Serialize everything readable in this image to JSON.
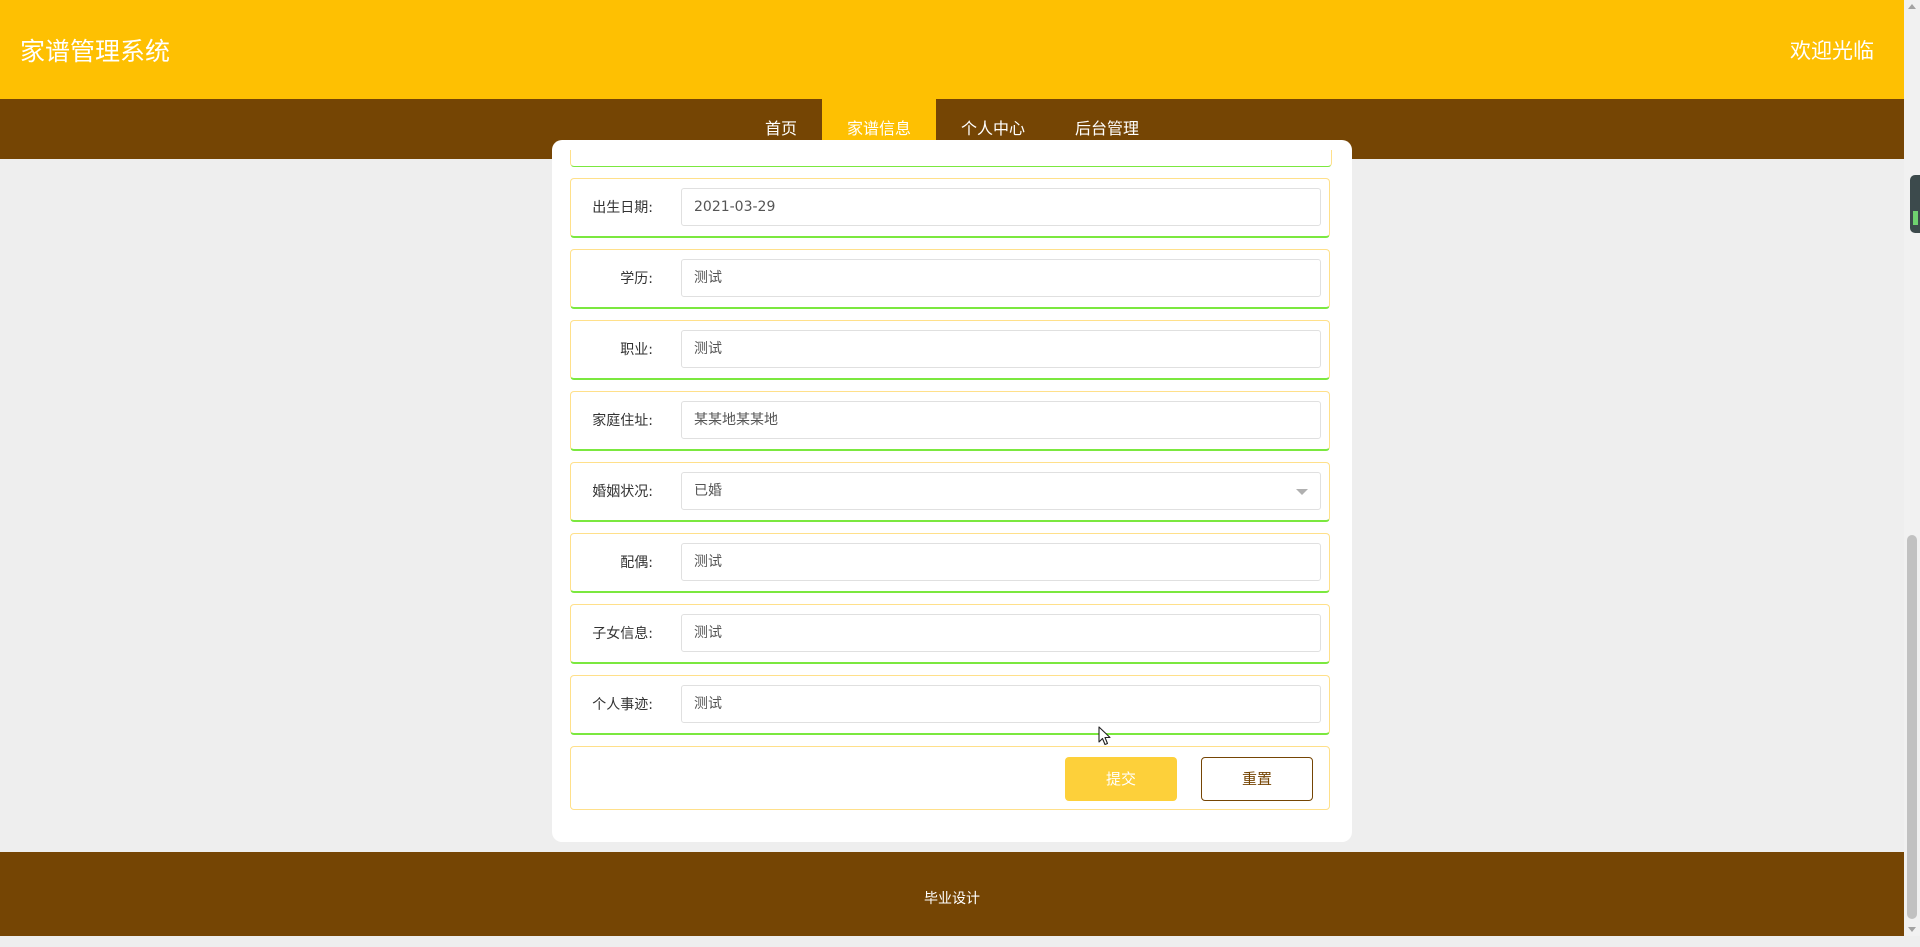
{
  "header": {
    "title": "家谱管理系统",
    "welcome": "欢迎光临"
  },
  "nav": {
    "items": [
      {
        "label": "首页"
      },
      {
        "label": "家谱信息"
      },
      {
        "label": "个人中心"
      },
      {
        "label": "后台管理"
      }
    ],
    "active": "家谱信息"
  },
  "form": {
    "birth_date": {
      "label": "出生日期:",
      "value": "2021-03-29"
    },
    "education": {
      "label": "学历:",
      "value": "测试"
    },
    "occupation": {
      "label": "职业:",
      "value": "测试"
    },
    "address": {
      "label": "家庭住址:",
      "value": "某某地某某地"
    },
    "marital_status": {
      "label": "婚姻状况:",
      "value": "已婚"
    },
    "spouse": {
      "label": "配偶:",
      "value": "测试"
    },
    "children": {
      "label": "子女信息:",
      "value": "测试"
    },
    "deeds": {
      "label": "个人事迹:",
      "value": "测试"
    }
  },
  "actions": {
    "submit": "提交",
    "reset": "重置"
  },
  "footer": {
    "text": "毕业设计"
  },
  "colors": {
    "header_bg": "#fec002",
    "nav_bg": "#754504",
    "nav_active_bg": "#fec002",
    "submit_bg": "#fdd03a",
    "row_border_bottom": "#7be83f"
  }
}
